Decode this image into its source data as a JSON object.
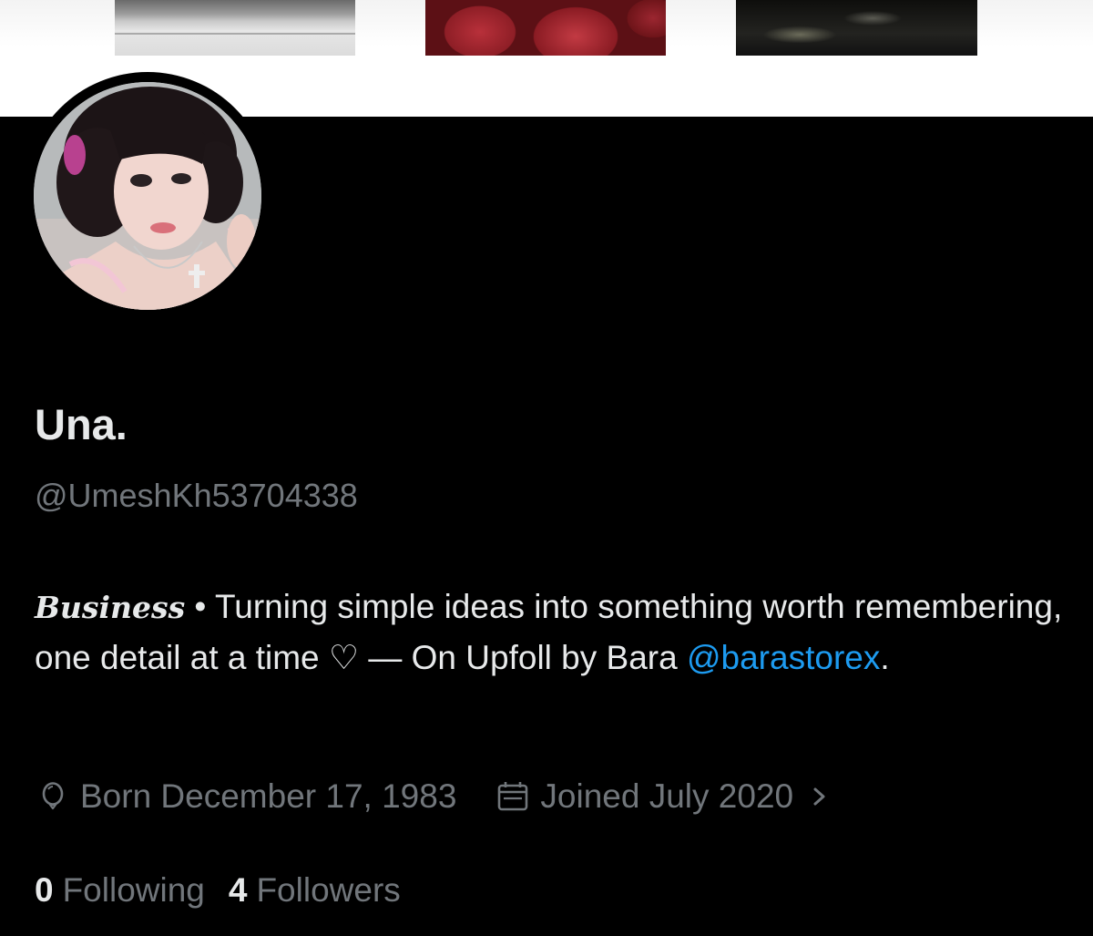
{
  "profile": {
    "display_name": "Una.",
    "handle": "@UmeshKh53704338",
    "bio": {
      "category": "Business",
      "separator": " • ",
      "text": "Turning simple ideas into something worth remembering, one detail at a time ♡ — On Upfoll by Bara ",
      "mention": "@barastorex",
      "trailing": "."
    },
    "born": "Born December 17, 1983",
    "joined": "Joined July 2020",
    "following_count": "0",
    "following_label": "Following",
    "followers_count": "4",
    "followers_label": "Followers"
  },
  "icons": {
    "born": "balloon-icon",
    "joined": "calendar-icon",
    "more": "chevron-right-icon"
  },
  "colors": {
    "background": "#000000",
    "primary_text": "#e7e9ea",
    "secondary_text": "#71767b",
    "link": "#1d9bf0"
  }
}
